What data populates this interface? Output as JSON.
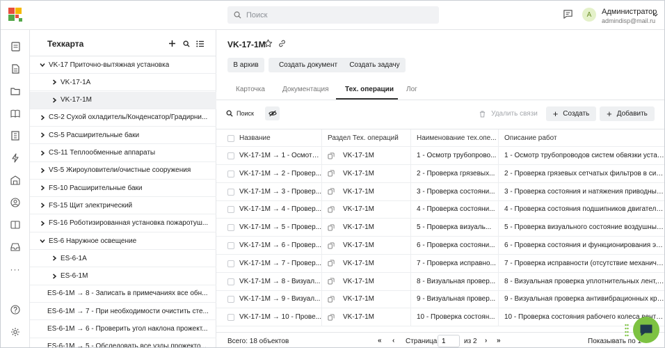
{
  "topbar": {
    "search_placeholder": "Поиск",
    "user_name": "Администратор",
    "user_email": "admindisp@mail.ru",
    "avatar_letter": "A"
  },
  "tree": {
    "title": "Техкарта",
    "items": [
      {
        "label": "VK-17 Приточно-вытяжная установка",
        "level": 0,
        "caret": "down"
      },
      {
        "label": "VK-17-1A",
        "level": 1,
        "caret": "right"
      },
      {
        "label": "VK-17-1M",
        "level": 1,
        "caret": "right",
        "selected": true
      },
      {
        "label": "CS-2 Сухой охладитель/Конденсатор/Градирни...",
        "level": 0,
        "caret": "right"
      },
      {
        "label": "CS-5 Расширительные баки",
        "level": 0,
        "caret": "right"
      },
      {
        "label": "CS-11 Теплообменные аппараты",
        "level": 0,
        "caret": "right"
      },
      {
        "label": "VS-5 Жироуловители/очистные сооружения",
        "level": 0,
        "caret": "right"
      },
      {
        "label": "FS-10 Расширительные баки",
        "level": 0,
        "caret": "right"
      },
      {
        "label": "FS-15 Щит электрический",
        "level": 0,
        "caret": "right"
      },
      {
        "label": "FS-16 Роботизированная установка пожаротуш...",
        "level": 0,
        "caret": "right"
      },
      {
        "label": "ES-6 Наружное освещение",
        "level": 0,
        "caret": "down"
      },
      {
        "label": "ES-6-1A",
        "level": 1,
        "caret": "right"
      },
      {
        "label": "ES-6-1M",
        "level": 1,
        "caret": "right"
      },
      {
        "label": "ES-6-1M → 8 - Записать в примечаниях все обн...",
        "level": 0,
        "caret": "none"
      },
      {
        "label": "ES-6-1M → 7 - При необходимости очистить сте...",
        "level": 0,
        "caret": "none"
      },
      {
        "label": "ES-6-1M → 6 - Проверить угол наклона прожект...",
        "level": 0,
        "caret": "none"
      },
      {
        "label": "ES-6-1M → 5 - Обследовать все узлы прожекто...",
        "level": 0,
        "caret": "none"
      }
    ]
  },
  "main": {
    "title": "VK-17-1M",
    "buttons": {
      "archive": "В архив",
      "create_doc": "Создать документ",
      "create_task": "Создать задачу"
    },
    "tabs": [
      "Карточка",
      "Документация",
      "Тех. операции",
      "Лог"
    ],
    "active_tab": "Тех. операции",
    "toolbar": {
      "search": "Поиск",
      "unlink": "Удалить связи",
      "create": "Создать",
      "add": "Добавить"
    },
    "table": {
      "columns": [
        "Название",
        "Раздел Тех. операций",
        "Наименование тех.опе...",
        "Описание работ"
      ],
      "rows": [
        [
          "VK-17-1M → 1 - Осмотр ...",
          "VK-17-1M",
          "1 - Осмотр трубопрово...",
          "1 - Осмотр трубопроводов систем обвязки устано..."
        ],
        [
          "VK-17-1M → 2 - Провер...",
          "VK-17-1M",
          "2 - Проверка грязевых...",
          "2 - Проверка грязевых сетчатых фильтров в систе..."
        ],
        [
          "VK-17-1M → 3 - Провер...",
          "VK-17-1M",
          "3 - Проверка состояни...",
          "3 - Проверка состояния и натяжения приводных р..."
        ],
        [
          "VK-17-1M → 4 - Провер...",
          "VK-17-1M",
          "4 - Проверка состояни...",
          "4 - Проверка состояния подшипников двигателя, ..."
        ],
        [
          "VK-17-1M → 5 - Провер...",
          "VK-17-1M",
          "5 - Проверка визуаль...",
          "5 - Проверка визуального состояние воздушных ..."
        ],
        [
          "VK-17-1M → 6 - Провер...",
          "VK-17-1M",
          "6 - Проверка состояни...",
          "6 - Проверка состояния и функционирования эле..."
        ],
        [
          "VK-17-1M → 7 - Провер...",
          "VK-17-1M",
          "7 - Проверка исправно...",
          "7 - Проверка исправности (отсутствие механичес..."
        ],
        [
          "VK-17-1M → 8 - Визуал...",
          "VK-17-1M",
          "8 - Визуальная провер...",
          "8 - Визуальная проверка уплотнительных лент, ви..."
        ],
        [
          "VK-17-1M → 9 - Визуал...",
          "VK-17-1M",
          "9 - Визуальная провер...",
          "9 - Визуальная проверка антивибрационных креп..."
        ],
        [
          "VK-17-1M → 10 - Прове...",
          "VK-17-1M",
          "10 - Проверка состоян...",
          "10 - Проверка состояния рабочего колеса вентил..."
        ]
      ]
    },
    "footer": {
      "total": "Всего: 18 объектов",
      "page_label": "Страница",
      "page_value": "1",
      "page_of": "из 2",
      "shown": "Показывать по 1"
    }
  },
  "colors": {
    "accent_green": "#7dc242",
    "logo_red": "#e84e3c",
    "logo_yellow": "#f5b800",
    "logo_green": "#54a84a"
  }
}
